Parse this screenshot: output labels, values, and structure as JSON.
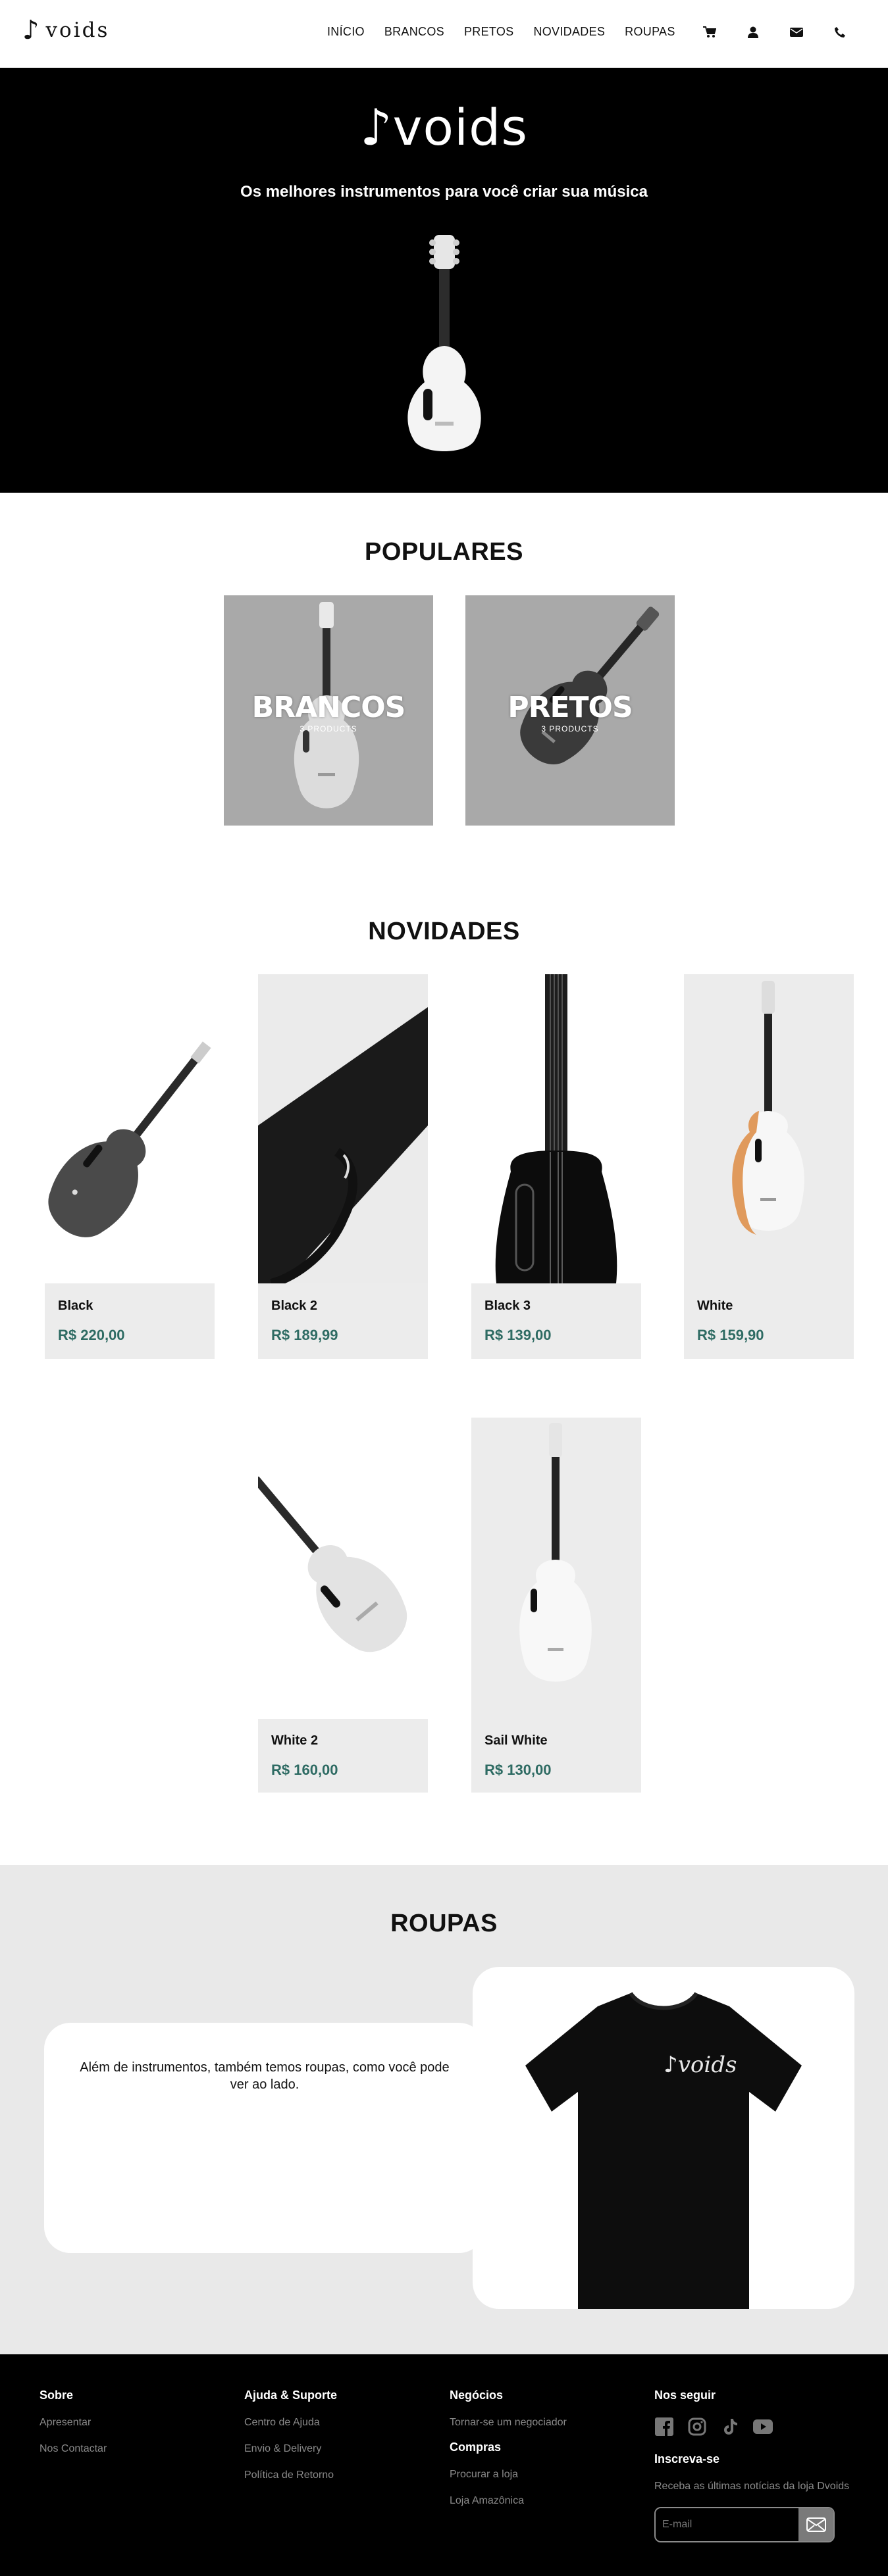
{
  "brand": {
    "logo_text": "voids",
    "logo_note": "♪"
  },
  "nav": {
    "items": [
      {
        "label": "INÍCIO"
      },
      {
        "label": "BRANCOS"
      },
      {
        "label": "PRETOS"
      },
      {
        "label": "NOVIDADES"
      },
      {
        "label": "ROUPAS"
      }
    ],
    "icons": [
      "cart-icon",
      "user-icon",
      "envelope-icon",
      "phone-icon"
    ]
  },
  "hero": {
    "logo": "♪voids",
    "tagline": "Os melhores instrumentos para você criar sua música"
  },
  "populares": {
    "title": "POPULARES",
    "collections": [
      {
        "label": "BRANCOS",
        "count": "3 PRODUCTS"
      },
      {
        "label": "PRETOS",
        "count": "3 PRODUCTS"
      }
    ]
  },
  "novidades": {
    "title": "NOVIDADES",
    "products": [
      {
        "name": "Black",
        "price": "R$ 220,00"
      },
      {
        "name": "Black 2",
        "price": "R$ 189,99"
      },
      {
        "name": "Black 3",
        "price": "R$ 139,00"
      },
      {
        "name": "White",
        "price": "R$ 159,90"
      },
      {
        "name": "White 2",
        "price": "R$ 160,00"
      },
      {
        "name": "Sail White",
        "price": "R$ 130,00"
      }
    ]
  },
  "roupas": {
    "title": "ROUPAS",
    "text": "Além de instrumentos, também temos roupas, como você pode ver ao lado.",
    "shirt_logo": "♪voids"
  },
  "footer": {
    "sobre": {
      "title": "Sobre",
      "links": [
        "Apresentar",
        "Nos Contactar"
      ]
    },
    "ajuda": {
      "title": "Ajuda & Suporte",
      "links": [
        "Centro de Ajuda",
        "Envio & Delivery",
        "Política de Retorno"
      ]
    },
    "negocios": {
      "title": "Negócios",
      "links": [
        "Tornar-se um negociador"
      ]
    },
    "compras": {
      "title": "Compras",
      "links": [
        "Procurar a loja",
        "Loja Amazônica"
      ]
    },
    "seguir": {
      "title": "Nos seguir",
      "icons": [
        "facebook-icon",
        "instagram-icon",
        "tiktok-icon",
        "youtube-icon"
      ]
    },
    "inscreva": {
      "title": "Inscreva-se",
      "text": "Receba as últimas notícias da loja Dvoids",
      "placeholder": "E-mail"
    }
  },
  "colors": {
    "price": "#2e6b63",
    "hero_bg": "#000000",
    "card_bg": "#ececec",
    "collection_bg": "#a9a9a9"
  }
}
